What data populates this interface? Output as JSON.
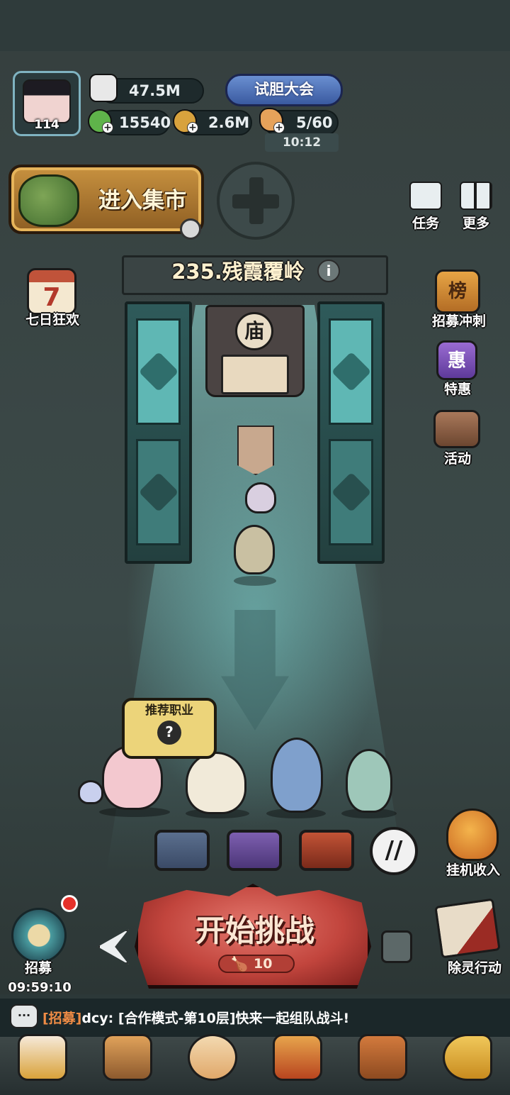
{
  "player": {
    "level": "114"
  },
  "resources": {
    "power": "47.5M",
    "jade": "15540",
    "coins": "2.6M",
    "stamina": "5/60",
    "stamina_timer": "10:12"
  },
  "event_banner": "试胆大会",
  "market_button": "进入集市",
  "top_right": {
    "tasks": "任务",
    "more": "更多"
  },
  "stage": {
    "title": "235.残霞覆岭",
    "info": "i",
    "shrine_sign": "庙"
  },
  "side_left": {
    "seven_day_number": "7",
    "seven_day_label": "七日狂欢"
  },
  "side_right": {
    "rank_glyph": "榜",
    "rank_label": "招募冲刺",
    "deal_glyph": "惠",
    "deal_label": "特惠",
    "activity_label": "活动"
  },
  "recommend": {
    "title": "推荐职业",
    "icon": "?"
  },
  "idle_income": "挂机收入",
  "recruit": {
    "label": "招募",
    "timer": "09:59:10"
  },
  "start_battle": {
    "label": "开始挑战",
    "cost": "10"
  },
  "exorcise": "除灵行动",
  "chat": {
    "tag": "[招募]",
    "message": "dcy: [合作模式-第10层]快来一起组队战斗!"
  },
  "colors": {
    "start_button": "#c2453d",
    "market_button": "#c7913f",
    "chat_tag": "#f08c45",
    "notification": "#e5312a"
  }
}
